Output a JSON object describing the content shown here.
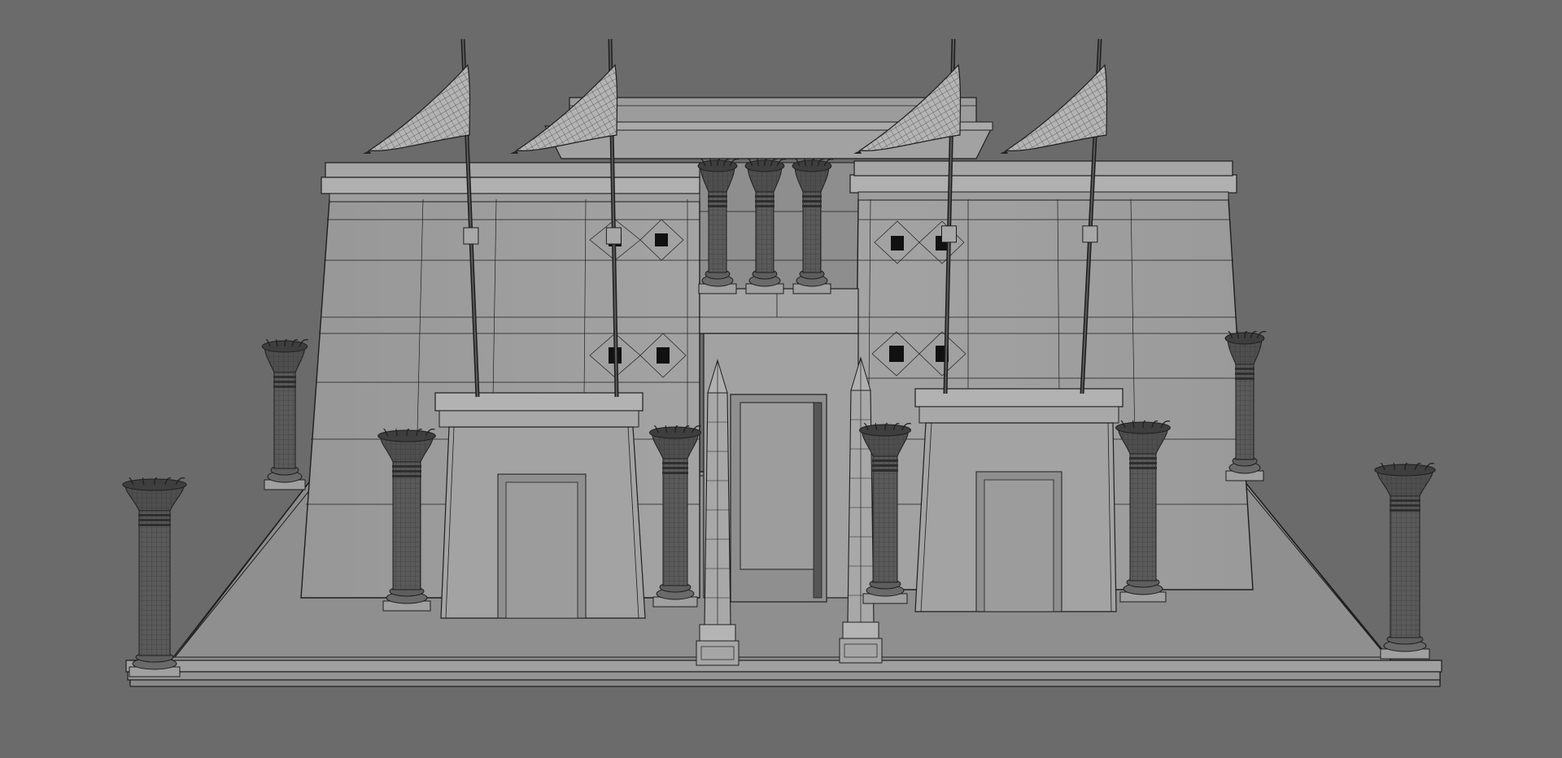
{
  "scene": {
    "subject": "egyptian-temple-pylon-wireframe",
    "colors": {
      "background": "#6b6b6b",
      "stone": "#9a9a9a",
      "stone_light": "#a8a8a8",
      "stone_dark": "#888888",
      "wire": "#1e1e1e",
      "column": "#5a5a5a",
      "flag": "#b4b4b4",
      "opening": "#8c8c8c"
    },
    "objects": {
      "flags": 4,
      "front_columns": 8,
      "courtyard_columns": 3,
      "obelisks": 2,
      "gateways": 2
    }
  }
}
